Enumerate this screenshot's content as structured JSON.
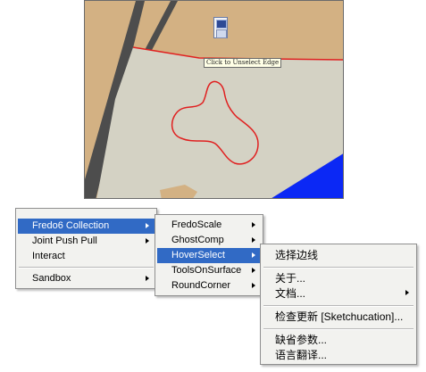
{
  "viewport": {
    "tooltip": "Click to Unselect Edge",
    "colors": {
      "land": "#d3b183",
      "face": "#d4d2c4",
      "sky": "#0b28f5",
      "road": "#4d4d4d",
      "edge": "#e02020"
    }
  },
  "toolbar": {
    "icons": [
      "hoverselect-icon",
      "hoverselect-mode-icon"
    ]
  },
  "menu_main": {
    "items": [
      {
        "label": "Fredo6 Collection",
        "submenu": true,
        "selected": true
      },
      {
        "label": "Joint Push Pull",
        "submenu": true
      },
      {
        "label": "Interact",
        "submenu": false
      },
      {
        "label": "Sandbox",
        "submenu": true
      }
    ]
  },
  "menu_fredo": {
    "items": [
      {
        "label": "FredoScale",
        "submenu": true
      },
      {
        "label": "GhostComp",
        "submenu": true
      },
      {
        "label": "HoverSelect",
        "submenu": true,
        "selected": true
      },
      {
        "label": "ToolsOnSurface",
        "submenu": true
      },
      {
        "label": "RoundCorner",
        "submenu": true
      }
    ]
  },
  "menu_hover": {
    "items": [
      {
        "label": "选择边线"
      },
      {
        "label": "关于..."
      },
      {
        "label": "文档...",
        "submenu": true
      },
      {
        "label": "检查更新 [Sketchucation]..."
      },
      {
        "label": "缺省参数..."
      },
      {
        "label": "语言翻译..."
      }
    ]
  },
  "colors": {
    "menu_bg": "#f2f2ef",
    "highlight": "#316ac5"
  }
}
